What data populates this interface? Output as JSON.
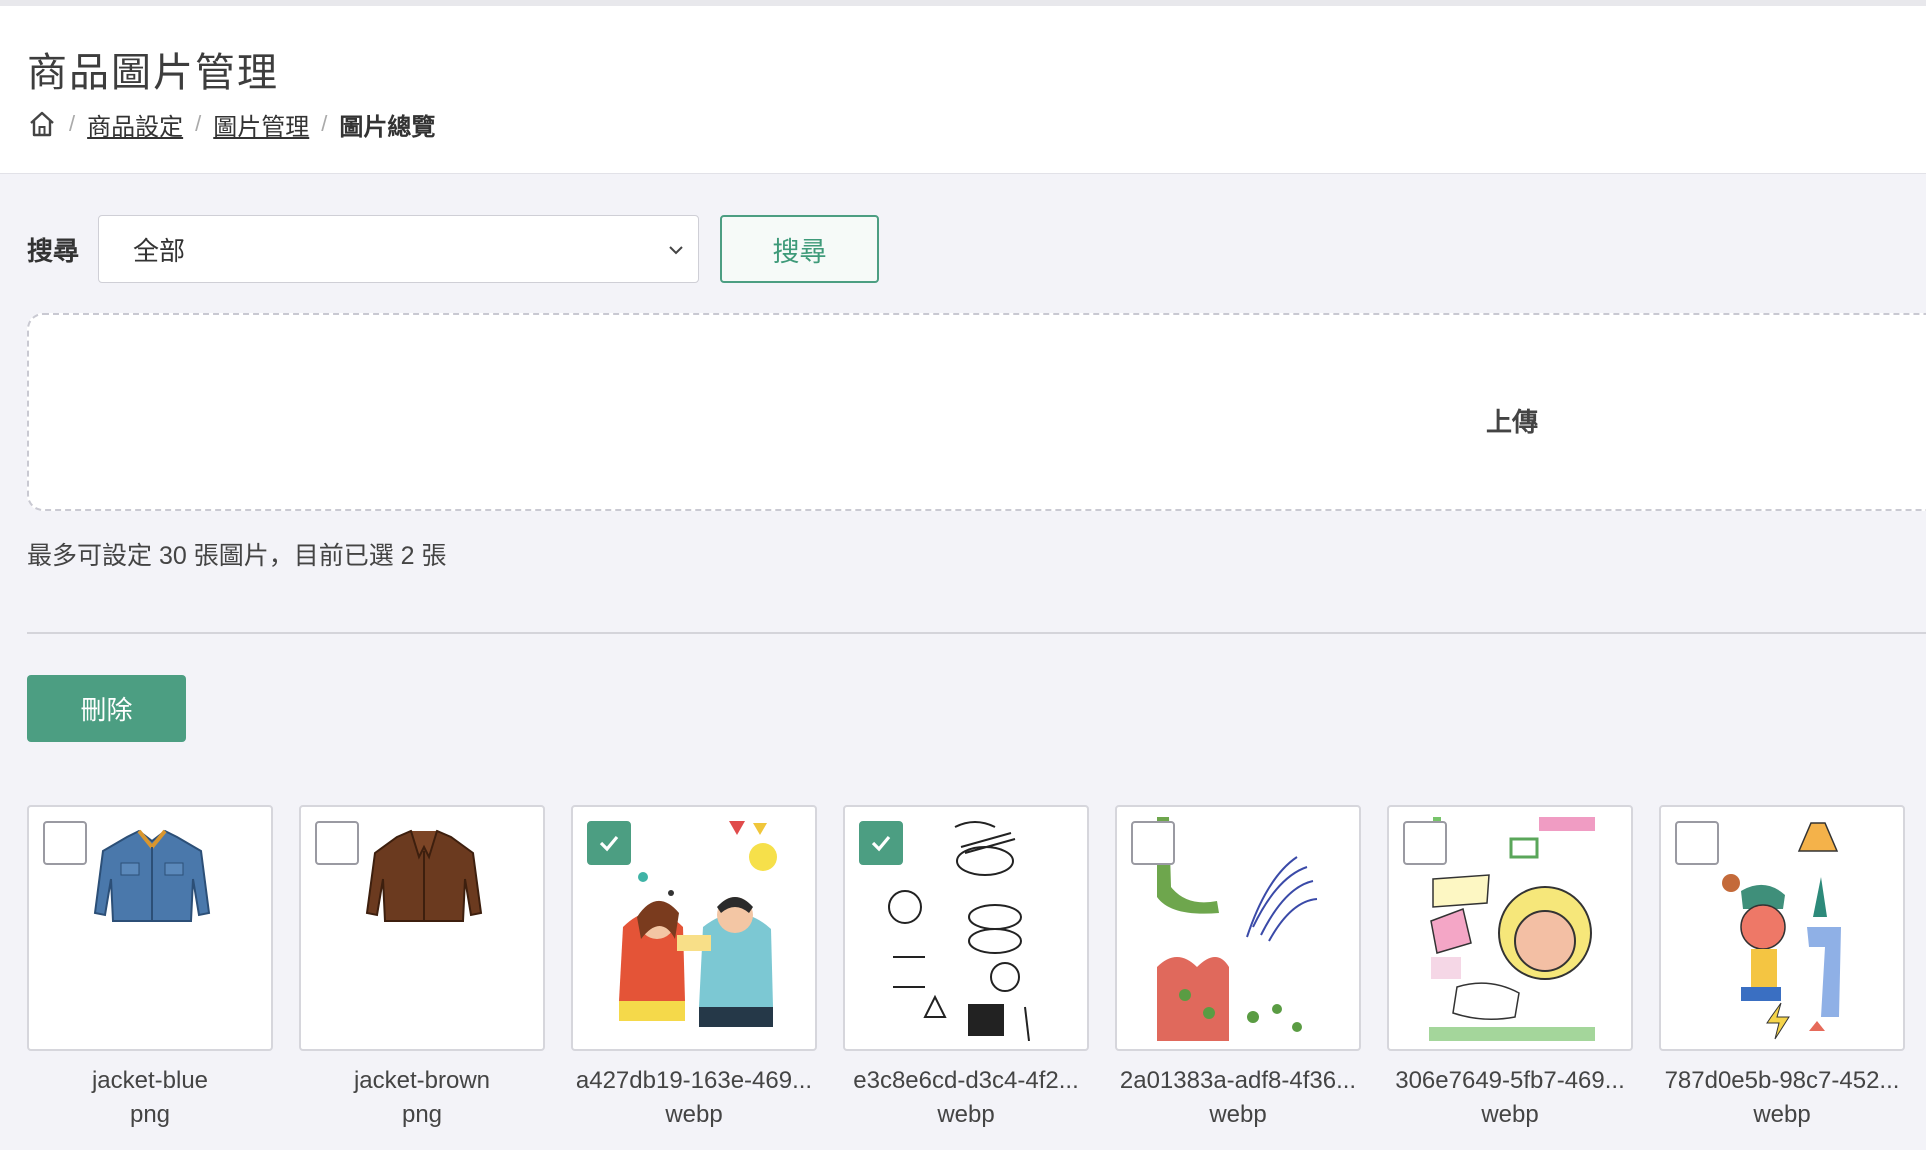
{
  "page": {
    "title": "商品圖片管理"
  },
  "breadcrumb": {
    "items": [
      {
        "label": "商品設定"
      },
      {
        "label": "圖片管理"
      }
    ],
    "current": "圖片總覽"
  },
  "search": {
    "label": "搜尋",
    "selected": "全部",
    "button_label": "搜尋"
  },
  "upload": {
    "label": "上傳"
  },
  "limit_text": "最多可設定 30 張圖片，目前已選 2 張",
  "actions": {
    "delete_label": "刪除"
  },
  "colors": {
    "accent": "#4c9e82",
    "background": "#f3f3f8"
  },
  "images": [
    {
      "name": "jacket-blue",
      "ext": "png",
      "checked": false,
      "thumb": "blue-jacket-image"
    },
    {
      "name": "jacket-brown",
      "ext": "png",
      "checked": false,
      "thumb": "brown-jacket-image"
    },
    {
      "name": "a427db19-163e-469...",
      "ext": "webp",
      "checked": true,
      "thumb": "party-illustration-image"
    },
    {
      "name": "e3c8e6cd-d3c4-4f2...",
      "ext": "webp",
      "checked": true,
      "thumb": "doodle-pattern-image"
    },
    {
      "name": "2a01383a-adf8-4f36...",
      "ext": "webp",
      "checked": false,
      "thumb": "botanical-illustration-image"
    },
    {
      "name": "306e7649-5fb7-469...",
      "ext": "webp",
      "checked": false,
      "thumb": "comic-collage-image"
    },
    {
      "name": "787d0e5b-98c7-452...",
      "ext": "webp",
      "checked": false,
      "thumb": "character-illustration-image"
    }
  ]
}
